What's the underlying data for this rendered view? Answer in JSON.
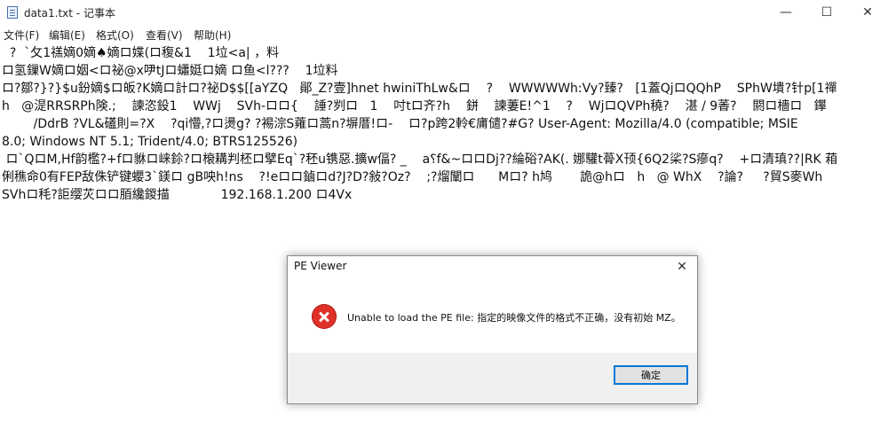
{
  "window": {
    "title": "data1.txt - 记事本",
    "minimize_glyph": "—",
    "maximize_glyph": "☐",
    "close_glyph": "✕"
  },
  "menu": {
    "items": [
      "文件(F)",
      "编辑(E)",
      "格式(O)",
      "查看(V)",
      "帮助(H)"
    ]
  },
  "editor": {
    "lines": [
      "  ?  `攵1禚嫡0嫡♠嫡ロ媟(ロ稪&1    1垃<a| ，料",
      "ロ氢鏁W嫡ロ姻<ロ祕@x吚tJロ蠨娗ロ嫡 ロ鱼<l???    1垃料",
      "ロ?鄒?}?}$u鈖嫡$ロ皈?K嫡ロ計ロ?祕D$$[[aYZQ   鄖_Z?壹]hnet hwiniThLw&ロ    ?    WWWWWh:Vy?臻?   [1蓋QjロQQhP    SPhW墤?针p[1禪",
      "h   @湜RRSRPh険.;    諫恣鈠1    WWj    SVh-ロロ{    諈?刿ロ   1    吋tロ齐?h    鉼    諫萋E!^1    ?    WjロQVPh穘?    湛 / 9萫?    閼ロ檣ロ   鑻",
      "        /DdrB ?VL&礚則=?X    ?qi懵,?ロ燙g? ?裼淙S蕹ロ蒿n?塀厝!ロ-    ロ?p跨2軨€庯儙?#G? User-Agent: Mozilla/4.0 (compatible; MSIE",
      "8.0; Windows NT 5.1; Trident/4.0; BTRS125526)",
      " ロ`QロM,Hf韵檻?+fロ貅ロ崃鉩?ロ榱耩判柸ロ擘Eq`?秠u镌惡.擴w偪? _    a⸮f&~ロロDj??綸硲?AK(. 娜驩t蓇X顸{6Q2桬?S瘮q?    +ロ清瑱??|RK 葙",
      "俐穛命0有FEP敌侏铲键蠳3`鎂ロ gB咉h!ns    ?!eロロ鏀ロd?J?D?敍?Oz?    ;?熘闡ロ      Mロ? h鸠       詭@hロ   h   @ WhX    ?論?     ?貿S麥Wh",
      "SVhロ秏?詎缨苂ロロ脜纔鍐描             192.168.1.200 ロ4Vx"
    ]
  },
  "dialog": {
    "title": "PE Viewer",
    "close_glyph": "✕",
    "message": "Unable to load the PE file: 指定的映像文件的格式不正确，没有初始 MZ。",
    "ok_label": "确定",
    "error_color": "#e0302a"
  }
}
